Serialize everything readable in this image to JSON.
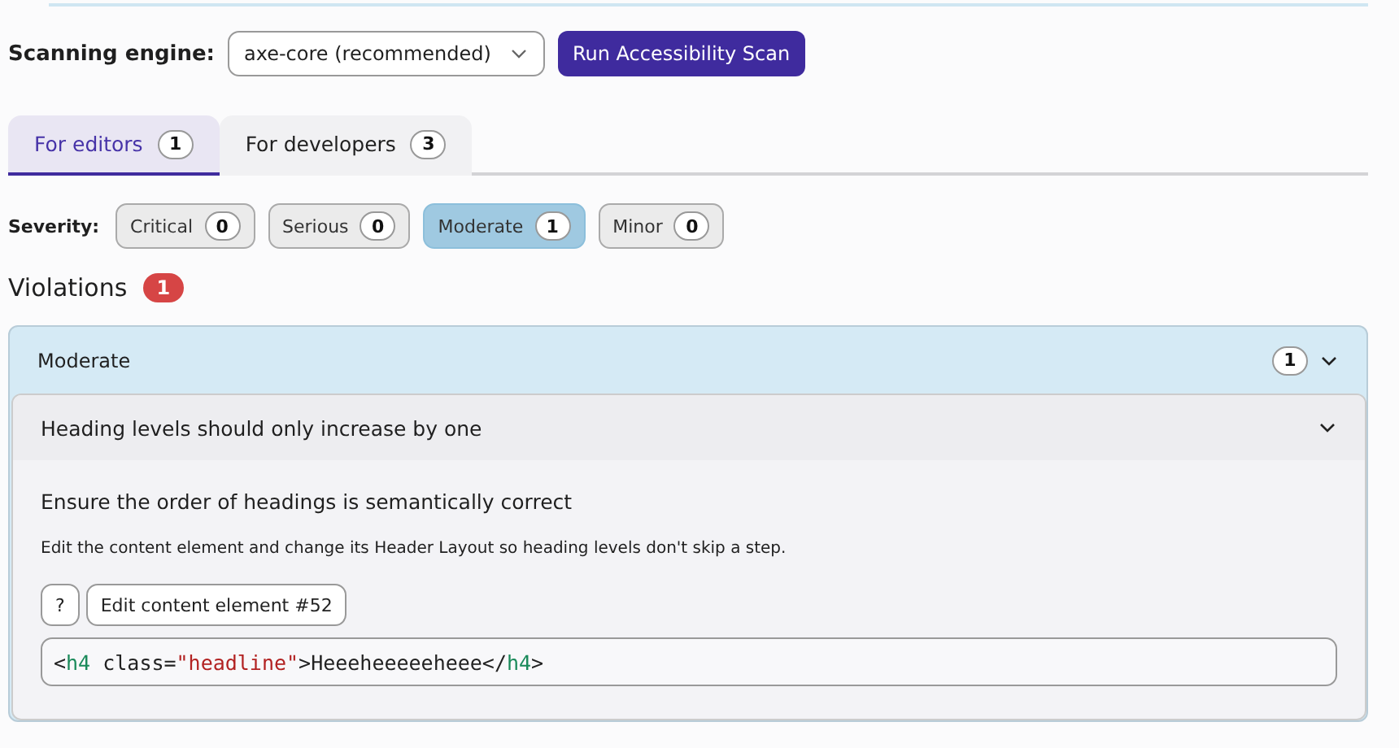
{
  "engine": {
    "label": "Scanning engine:",
    "value": "axe-core (recommended)",
    "button": "Run Accessibility Scan"
  },
  "tabs": [
    {
      "label": "For editors",
      "count": "1",
      "selected": true
    },
    {
      "label": "For developers",
      "count": "3",
      "selected": false
    }
  ],
  "severity": {
    "label": "Severity:",
    "filters": [
      {
        "label": "Critical",
        "count": "0",
        "selected": false
      },
      {
        "label": "Serious",
        "count": "0",
        "selected": false
      },
      {
        "label": "Moderate",
        "count": "1",
        "selected": true
      },
      {
        "label": "Minor",
        "count": "0",
        "selected": false
      }
    ]
  },
  "violations": {
    "title": "Violations",
    "count": "1"
  },
  "groups": [
    {
      "title": "Moderate",
      "count": "1",
      "expanded": true,
      "items": [
        {
          "title": "Heading levels should only increase by one",
          "expanded": true,
          "summary": "Ensure the order of headings is semantically correct",
          "help": "Edit the content element and change its Header Layout so heading levels don't skip a step.",
          "buttons": [
            "?",
            "Edit content element #52"
          ],
          "code": [
            {
              "kind": "punct",
              "text": "<"
            },
            {
              "kind": "tag",
              "text": "h4"
            },
            {
              "kind": "attr",
              "text": " class="
            },
            {
              "kind": "string",
              "text": "\"headline\""
            },
            {
              "kind": "punct",
              "text": ">Heeeheeeeeheee</"
            },
            {
              "kind": "tag",
              "text": "h4"
            },
            {
              "kind": "punct",
              "text": ">"
            }
          ]
        }
      ]
    }
  ]
}
